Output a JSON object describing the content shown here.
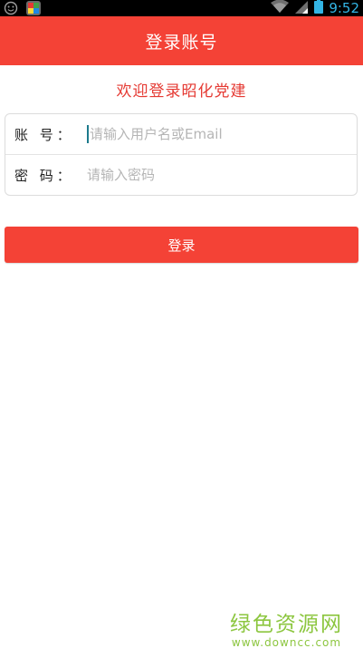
{
  "status_bar": {
    "time": "9:52",
    "icons": [
      "smiley-icon",
      "app-icon",
      "wifi-icon",
      "signal-icon",
      "battery-icon"
    ]
  },
  "header": {
    "title": "登录账号"
  },
  "welcome": {
    "text": "欢迎登录昭化党建"
  },
  "form": {
    "account_label": "账 号：",
    "account_placeholder": "请输入用户名或Email",
    "password_label": "密 码：",
    "password_placeholder": "请输入密码"
  },
  "login_button": {
    "label": "登录"
  },
  "watermark": {
    "text": "绿色资源网",
    "url": "www.downcc.com"
  },
  "colors": {
    "primary": "#f44236",
    "welcome_text": "#e53a33",
    "statusbar_icons": "#33b5e5",
    "watermark": "#8cc63f"
  }
}
